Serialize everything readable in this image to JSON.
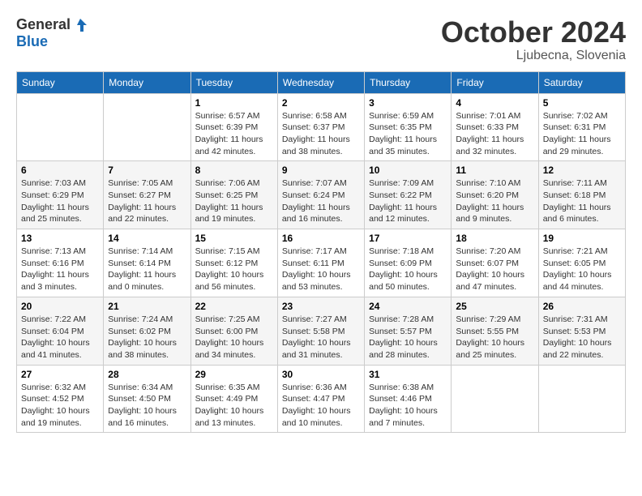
{
  "header": {
    "logo_general": "General",
    "logo_blue": "Blue",
    "month": "October 2024",
    "location": "Ljubecna, Slovenia"
  },
  "weekdays": [
    "Sunday",
    "Monday",
    "Tuesday",
    "Wednesday",
    "Thursday",
    "Friday",
    "Saturday"
  ],
  "weeks": [
    [
      {
        "day": "",
        "info": ""
      },
      {
        "day": "",
        "info": ""
      },
      {
        "day": "1",
        "info": "Sunrise: 6:57 AM\nSunset: 6:39 PM\nDaylight: 11 hours and 42 minutes."
      },
      {
        "day": "2",
        "info": "Sunrise: 6:58 AM\nSunset: 6:37 PM\nDaylight: 11 hours and 38 minutes."
      },
      {
        "day": "3",
        "info": "Sunrise: 6:59 AM\nSunset: 6:35 PM\nDaylight: 11 hours and 35 minutes."
      },
      {
        "day": "4",
        "info": "Sunrise: 7:01 AM\nSunset: 6:33 PM\nDaylight: 11 hours and 32 minutes."
      },
      {
        "day": "5",
        "info": "Sunrise: 7:02 AM\nSunset: 6:31 PM\nDaylight: 11 hours and 29 minutes."
      }
    ],
    [
      {
        "day": "6",
        "info": "Sunrise: 7:03 AM\nSunset: 6:29 PM\nDaylight: 11 hours and 25 minutes."
      },
      {
        "day": "7",
        "info": "Sunrise: 7:05 AM\nSunset: 6:27 PM\nDaylight: 11 hours and 22 minutes."
      },
      {
        "day": "8",
        "info": "Sunrise: 7:06 AM\nSunset: 6:25 PM\nDaylight: 11 hours and 19 minutes."
      },
      {
        "day": "9",
        "info": "Sunrise: 7:07 AM\nSunset: 6:24 PM\nDaylight: 11 hours and 16 minutes."
      },
      {
        "day": "10",
        "info": "Sunrise: 7:09 AM\nSunset: 6:22 PM\nDaylight: 11 hours and 12 minutes."
      },
      {
        "day": "11",
        "info": "Sunrise: 7:10 AM\nSunset: 6:20 PM\nDaylight: 11 hours and 9 minutes."
      },
      {
        "day": "12",
        "info": "Sunrise: 7:11 AM\nSunset: 6:18 PM\nDaylight: 11 hours and 6 minutes."
      }
    ],
    [
      {
        "day": "13",
        "info": "Sunrise: 7:13 AM\nSunset: 6:16 PM\nDaylight: 11 hours and 3 minutes."
      },
      {
        "day": "14",
        "info": "Sunrise: 7:14 AM\nSunset: 6:14 PM\nDaylight: 11 hours and 0 minutes."
      },
      {
        "day": "15",
        "info": "Sunrise: 7:15 AM\nSunset: 6:12 PM\nDaylight: 10 hours and 56 minutes."
      },
      {
        "day": "16",
        "info": "Sunrise: 7:17 AM\nSunset: 6:11 PM\nDaylight: 10 hours and 53 minutes."
      },
      {
        "day": "17",
        "info": "Sunrise: 7:18 AM\nSunset: 6:09 PM\nDaylight: 10 hours and 50 minutes."
      },
      {
        "day": "18",
        "info": "Sunrise: 7:20 AM\nSunset: 6:07 PM\nDaylight: 10 hours and 47 minutes."
      },
      {
        "day": "19",
        "info": "Sunrise: 7:21 AM\nSunset: 6:05 PM\nDaylight: 10 hours and 44 minutes."
      }
    ],
    [
      {
        "day": "20",
        "info": "Sunrise: 7:22 AM\nSunset: 6:04 PM\nDaylight: 10 hours and 41 minutes."
      },
      {
        "day": "21",
        "info": "Sunrise: 7:24 AM\nSunset: 6:02 PM\nDaylight: 10 hours and 38 minutes."
      },
      {
        "day": "22",
        "info": "Sunrise: 7:25 AM\nSunset: 6:00 PM\nDaylight: 10 hours and 34 minutes."
      },
      {
        "day": "23",
        "info": "Sunrise: 7:27 AM\nSunset: 5:58 PM\nDaylight: 10 hours and 31 minutes."
      },
      {
        "day": "24",
        "info": "Sunrise: 7:28 AM\nSunset: 5:57 PM\nDaylight: 10 hours and 28 minutes."
      },
      {
        "day": "25",
        "info": "Sunrise: 7:29 AM\nSunset: 5:55 PM\nDaylight: 10 hours and 25 minutes."
      },
      {
        "day": "26",
        "info": "Sunrise: 7:31 AM\nSunset: 5:53 PM\nDaylight: 10 hours and 22 minutes."
      }
    ],
    [
      {
        "day": "27",
        "info": "Sunrise: 6:32 AM\nSunset: 4:52 PM\nDaylight: 10 hours and 19 minutes."
      },
      {
        "day": "28",
        "info": "Sunrise: 6:34 AM\nSunset: 4:50 PM\nDaylight: 10 hours and 16 minutes."
      },
      {
        "day": "29",
        "info": "Sunrise: 6:35 AM\nSunset: 4:49 PM\nDaylight: 10 hours and 13 minutes."
      },
      {
        "day": "30",
        "info": "Sunrise: 6:36 AM\nSunset: 4:47 PM\nDaylight: 10 hours and 10 minutes."
      },
      {
        "day": "31",
        "info": "Sunrise: 6:38 AM\nSunset: 4:46 PM\nDaylight: 10 hours and 7 minutes."
      },
      {
        "day": "",
        "info": ""
      },
      {
        "day": "",
        "info": ""
      }
    ]
  ]
}
